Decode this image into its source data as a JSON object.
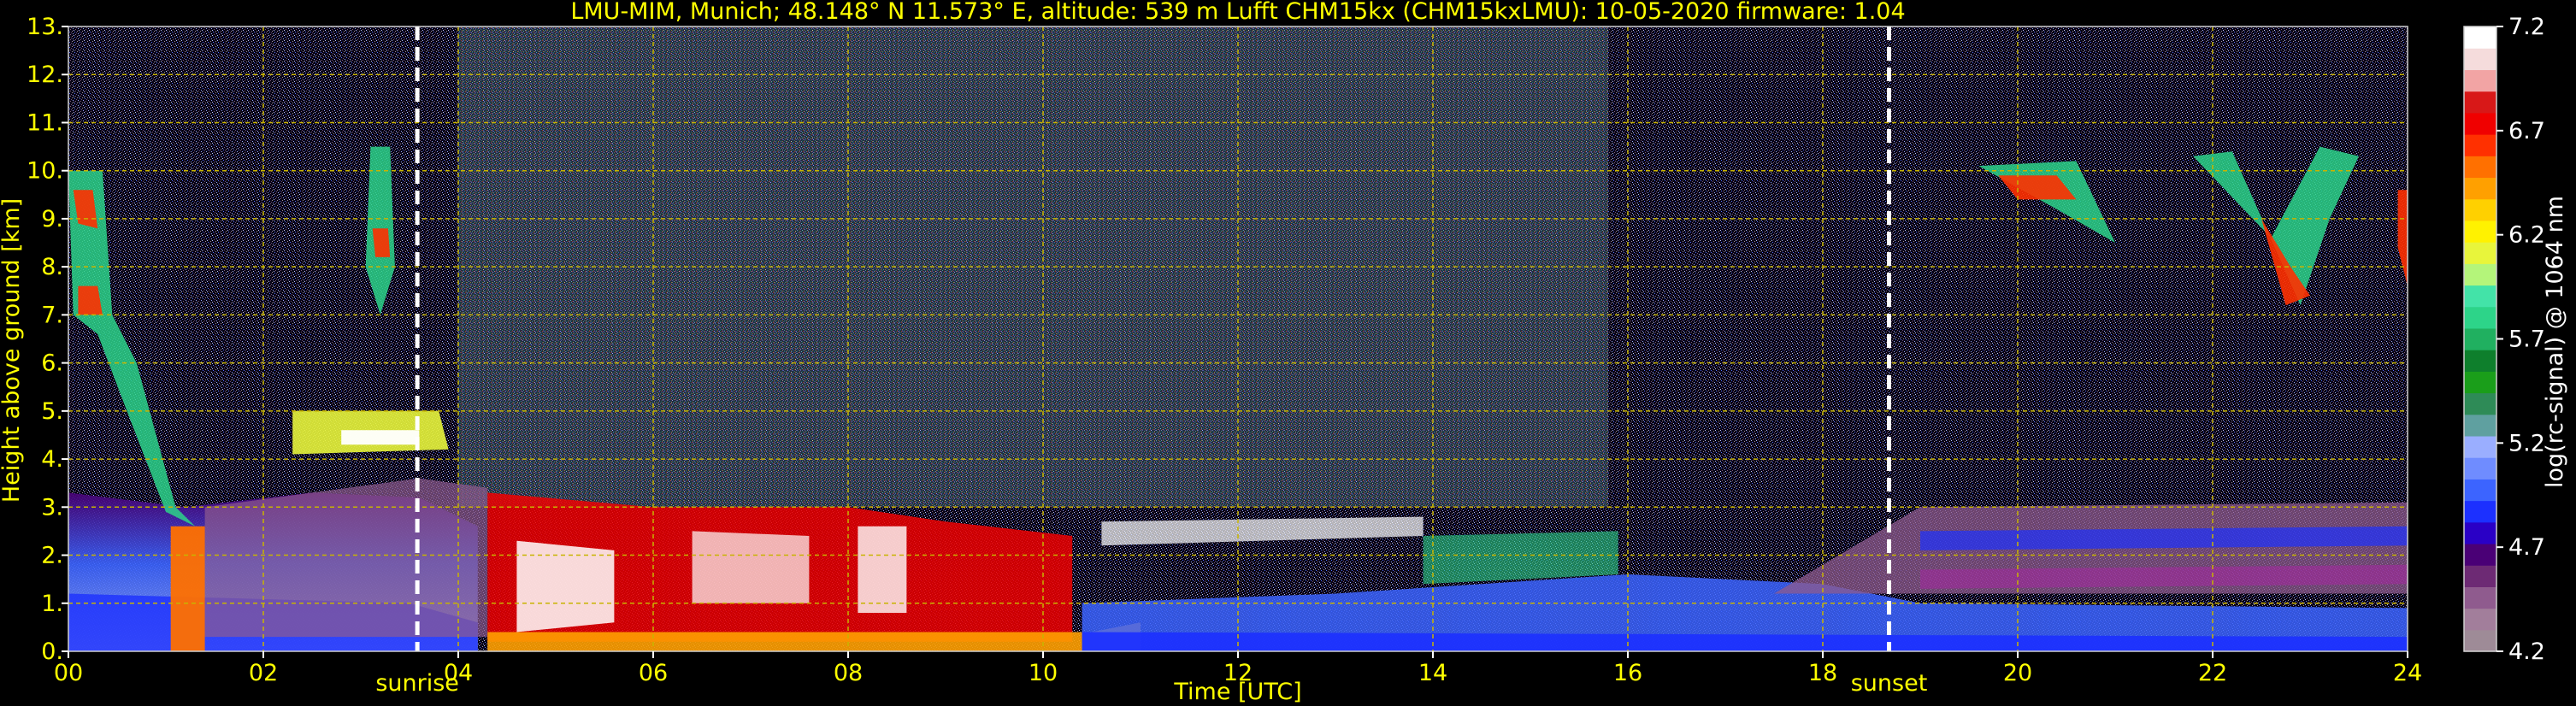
{
  "chart_data": {
    "type": "heatmap",
    "title": "LMU-MIM, Munich; 48.148° N 11.573° E, altitude: 539 m    Lufft CHM15kx (CHM15kxLMU): 10-05-2020    firmware: 1.04",
    "xlabel": "Time [UTC]",
    "ylabel": "Height above ground [km]",
    "xlim": [
      0,
      24
    ],
    "ylim": [
      0,
      13
    ],
    "x_ticks": [
      "00",
      "02",
      "04",
      "06",
      "08",
      "10",
      "12",
      "14",
      "16",
      "18",
      "20",
      "22",
      "24"
    ],
    "y_ticks": [
      "0.",
      "1.",
      "2.",
      "3.",
      "4.",
      "5.",
      "6.",
      "7.",
      "8.",
      "9.",
      "10.",
      "11.",
      "12.",
      "13."
    ],
    "grid": true,
    "annotations": [
      {
        "label": "sunrise",
        "time": 3.58
      },
      {
        "label": "sunset",
        "time": 18.68
      }
    ],
    "colorbar": {
      "label": "log(rc-signal) @ 1064 nm",
      "range": [
        4.2,
        7.2
      ],
      "ticks": [
        "4.2",
        "4.7",
        "5.2",
        "5.7",
        "6.2",
        "6.7",
        "7.2"
      ],
      "colors": [
        "#9e8b97",
        "#a27e9b",
        "#8f5b8e",
        "#6d2a74",
        "#4a0076",
        "#2a00c6",
        "#1c30ff",
        "#3c64ff",
        "#6f8cff",
        "#9aaeff",
        "#5fa0a0",
        "#2e8b57",
        "#1a9e1a",
        "#0e7f2c",
        "#20b060",
        "#2dd489",
        "#43e3a8",
        "#b4f57a",
        "#e8f53b",
        "#fff200",
        "#ffd000",
        "#ffa000",
        "#ff7000",
        "#ff3000",
        "#f00000",
        "#d81818",
        "#f2a4a4",
        "#f5dcdc",
        "#ffffff"
      ]
    }
  },
  "colors": {
    "text": "#ffff00",
    "grid": "#c8b400",
    "background": "#000000",
    "marker": "#ffffff"
  }
}
